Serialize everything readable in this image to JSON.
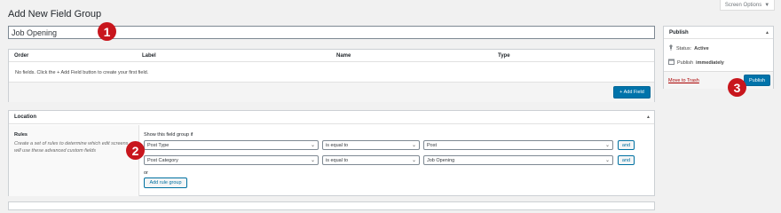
{
  "screen_options": {
    "label": "Screen Options",
    "arrow": "▼"
  },
  "page_title": "Add New Field Group",
  "title_input": {
    "value": "Job Opening"
  },
  "fields": {
    "columns": [
      "Order",
      "Label",
      "Name",
      "Type"
    ],
    "empty_text": "No fields. Click the + Add Field button to create your first field.",
    "add_button": "+ Add Field"
  },
  "location": {
    "title": "Location",
    "rules_label": "Rules",
    "rules_desc": "Create a set of rules to determine which edit screens will use these advanced custom fields",
    "show_if": "Show this field group if",
    "rules": [
      {
        "param": "Post Type",
        "operator": "is equal to",
        "value": "Post",
        "and": "and"
      },
      {
        "param": "Post Category",
        "operator": "is equal to",
        "value": "Job Opening",
        "and": "and"
      }
    ],
    "or_label": "or",
    "add_group": "Add rule group"
  },
  "publish": {
    "title": "Publish",
    "status_label": "Status:",
    "status_value": "Active",
    "publish_label": "Publish",
    "publish_value": "immediately",
    "trash": "Move to Trash",
    "button": "Publish"
  },
  "markers": [
    "1",
    "2",
    "3"
  ],
  "colors": {
    "primary": "#0073aa",
    "marker": "#c8161d",
    "trash": "#aa0000"
  },
  "icons": {
    "toggle": "triangle-up-icon",
    "select": "chevron-down-icon",
    "status": "pin-icon",
    "calendar": "calendar-icon"
  }
}
